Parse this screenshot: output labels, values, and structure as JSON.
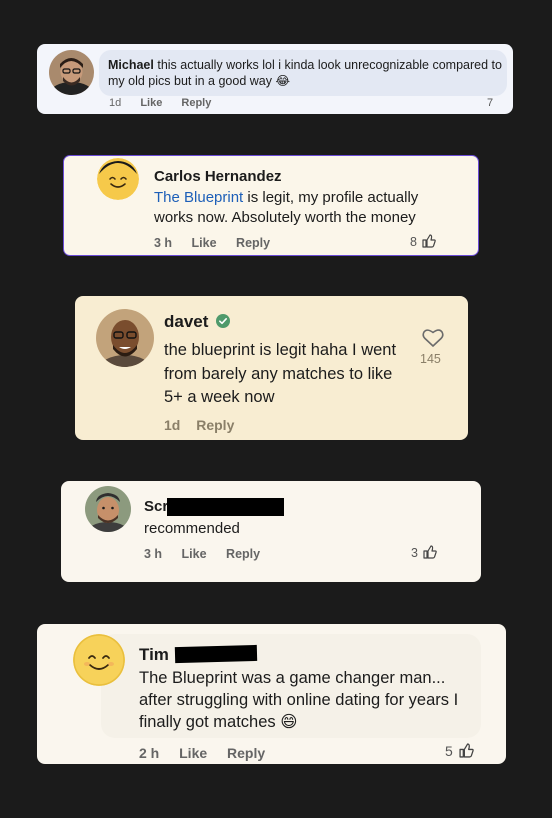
{
  "comments": [
    {
      "name": "Michael",
      "text": "this actually works lol i kinda look unrecognizable compared to my old pics but in a good way 😂",
      "time": "1d",
      "like": "Like",
      "reply": "Reply",
      "count": "7"
    },
    {
      "name": "Carlos Hernandez",
      "link": "The Blueprint",
      "text_rest": " is legit, my profile actually works now. Absolutely worth the money",
      "time": "3 h",
      "like": "Like",
      "reply": "Reply",
      "count": "8"
    },
    {
      "name": "davet",
      "text": "the blueprint is legit haha I went from barely any matches to like 5+ a week now",
      "time": "1d",
      "reply": "Reply",
      "likes": "145"
    },
    {
      "name_visible": "Scr",
      "text": "recommended",
      "time": "3 h",
      "like": "Like",
      "reply": "Reply",
      "count": "3"
    },
    {
      "name_visible": "Tim",
      "text": "The Blueprint was a game changer man... after struggling with online dating for years I finally got matches 😄",
      "time": "2 h",
      "like": "Like",
      "reply": "Reply",
      "count": "5"
    }
  ],
  "colors": {
    "background": "#1b1b1b",
    "card1": "#e8ecf6",
    "card2": "#fbf6ea",
    "card3": "#f8edd2",
    "card4": "#faf6ee",
    "card5": "#faf6ee",
    "verified": "#4f9a6b",
    "link": "#1d5fb8",
    "selection_border": "#6a4bd6"
  }
}
